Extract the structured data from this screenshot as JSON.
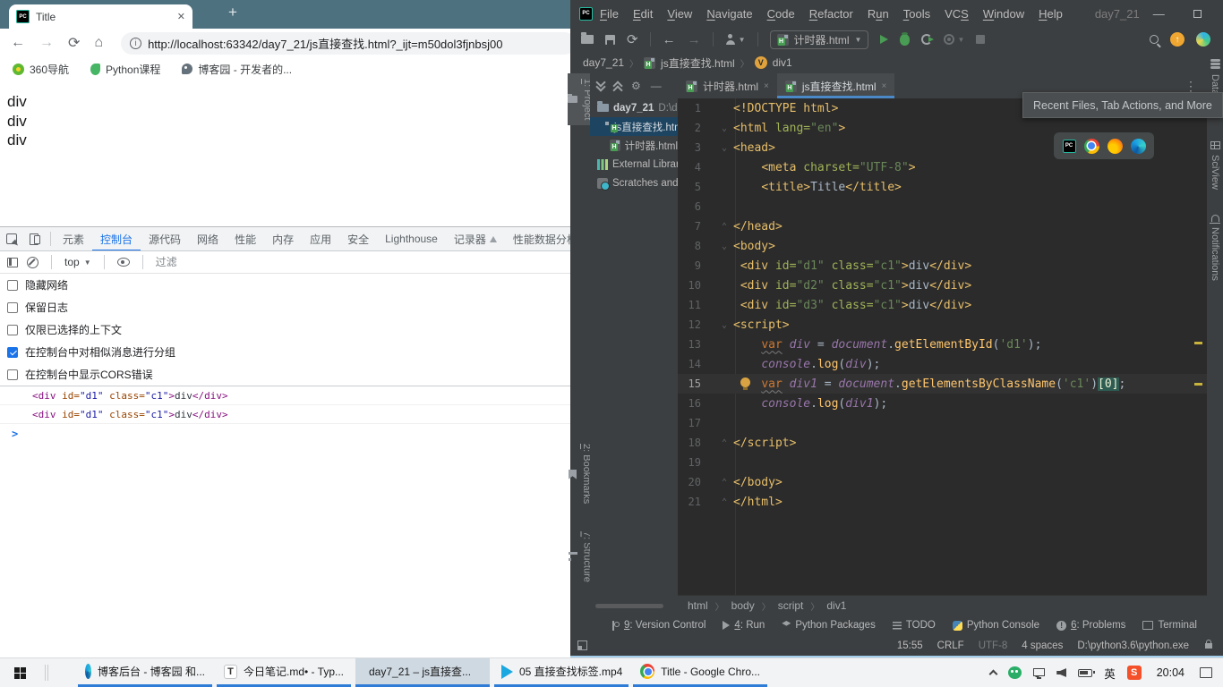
{
  "chrome": {
    "tab_title": "Title",
    "new_tab": "+",
    "url": "http://localhost:63342/day7_21/js直接查找.html?_ijt=m50dol3fjnbsj00",
    "bookmarks": [
      {
        "icon": "nav360",
        "label": "360导航"
      },
      {
        "icon": "pyclass",
        "label": "Python课程"
      },
      {
        "icon": "blog",
        "label": "博客园 - 开发者的..."
      }
    ],
    "page_lines": [
      "div",
      "div",
      "div"
    ],
    "devtools": {
      "tabs": [
        {
          "label": "元素"
        },
        {
          "label": "控制台",
          "active": true
        },
        {
          "label": "源代码"
        },
        {
          "label": "网络"
        },
        {
          "label": "性能"
        },
        {
          "label": "内存"
        },
        {
          "label": "应用"
        },
        {
          "label": "安全"
        },
        {
          "label": "Lighthouse"
        },
        {
          "label": "记录器",
          "badge": true
        },
        {
          "label": "性能数据分析"
        }
      ],
      "context": "top",
      "filter_placeholder": "过滤",
      "checkboxes": [
        {
          "label": "隐藏网络",
          "checked": false
        },
        {
          "label": "保留日志",
          "checked": false
        },
        {
          "label": "仅限已选择的上下文",
          "checked": false
        },
        {
          "label": "在控制台中对相似消息进行分组",
          "checked": true
        },
        {
          "label": "在控制台中显示CORS错误",
          "checked": false
        }
      ],
      "messages": [
        [
          [
            "t",
            "<div"
          ],
          [
            "a",
            " id="
          ],
          [
            "v",
            "\"d1\""
          ],
          [
            "a",
            " class="
          ],
          [
            "v",
            "\"c1\""
          ],
          [
            "t",
            ">"
          ],
          [
            "x",
            "div"
          ],
          [
            "t",
            "</div>"
          ]
        ],
        [
          [
            "t",
            "<div"
          ],
          [
            "a",
            " id="
          ],
          [
            "v",
            "\"d1\""
          ],
          [
            "a",
            " class="
          ],
          [
            "v",
            "\"c1\""
          ],
          [
            "t",
            ">"
          ],
          [
            "x",
            "div"
          ],
          [
            "t",
            "</div>"
          ]
        ]
      ],
      "prompt": ">"
    }
  },
  "pycharm": {
    "menus": [
      {
        "label": "File",
        "u": 0
      },
      {
        "label": "Edit",
        "u": 0
      },
      {
        "label": "View",
        "u": 0
      },
      {
        "label": "Navigate",
        "u": 0
      },
      {
        "label": "Code",
        "u": 0
      },
      {
        "label": "Refactor",
        "u": 0
      },
      {
        "label": "Run",
        "u": 1
      },
      {
        "label": "Tools",
        "u": 0
      },
      {
        "label": "VCS",
        "u": 2
      },
      {
        "label": "Window",
        "u": 0
      },
      {
        "label": "Help",
        "u": 0
      }
    ],
    "window_title": "day7_21",
    "run_config": "计时器.html",
    "crumbs_top": [
      "day7_21",
      "js直接查找.html",
      "div1"
    ],
    "left_strip": [
      {
        "key": "1",
        "label": "Project",
        "icon": "project",
        "active": true,
        "gap": 0
      },
      {
        "key": "2",
        "label": "Bookmarks",
        "icon": "bookmark",
        "gap": 350
      },
      {
        "key": "7",
        "label": "Structure",
        "icon": "structure",
        "gap": 18
      }
    ],
    "project_tree": [
      {
        "label": "day7_21",
        "suffix": " D:\\d",
        "icon": "folder",
        "indent": 0,
        "bold": true
      },
      {
        "label": "js直接查找.html",
        "icon": "html",
        "indent": 1,
        "selected": true
      },
      {
        "label": "计时器.html",
        "icon": "html",
        "indent": 1
      },
      {
        "label": "External Libraries",
        "icon": "libs",
        "indent": 0
      },
      {
        "label": "Scratches and Consoles",
        "icon": "scratch",
        "indent": 0
      }
    ],
    "tabs": [
      {
        "label": "计时器.html"
      },
      {
        "label": "js直接查找.html",
        "active": true
      }
    ],
    "tab_close": "×",
    "tooltip": "Recent Files, Tab Actions, and More",
    "code_lines": [
      {
        "n": 1,
        "tokens": [
          [
            "tag",
            "<!DOCTYPE html>"
          ]
        ]
      },
      {
        "n": 2,
        "fold": "o",
        "tokens": [
          [
            "tag",
            "<html"
          ],
          [
            "attr",
            " lang="
          ],
          [
            "str",
            "\"en\""
          ],
          [
            "tag",
            ">"
          ]
        ]
      },
      {
        "n": 3,
        "fold": "o",
        "tokens": [
          [
            "tag",
            "<head>"
          ]
        ]
      },
      {
        "n": 4,
        "tokens": [
          [
            "plain",
            "    "
          ],
          [
            "tag",
            "<meta"
          ],
          [
            "attr",
            " charset="
          ],
          [
            "str",
            "\"UTF-8\""
          ],
          [
            "tag",
            ">"
          ]
        ]
      },
      {
        "n": 5,
        "tokens": [
          [
            "plain",
            "    "
          ],
          [
            "tag",
            "<title>"
          ],
          [
            "text",
            "Title"
          ],
          [
            "tag",
            "</title>"
          ]
        ]
      },
      {
        "n": 6,
        "tokens": []
      },
      {
        "n": 7,
        "fold": "c",
        "tokens": [
          [
            "tag",
            "</head>"
          ]
        ]
      },
      {
        "n": 8,
        "fold": "o",
        "tokens": [
          [
            "tag",
            "<body>"
          ]
        ]
      },
      {
        "n": 9,
        "tokens": [
          [
            "plain",
            " "
          ],
          [
            "tag",
            "<div"
          ],
          [
            "attr",
            " id="
          ],
          [
            "str",
            "\"d1\""
          ],
          [
            "attr",
            " class="
          ],
          [
            "str",
            "\"c1\""
          ],
          [
            "tag",
            ">"
          ],
          [
            "text",
            "div"
          ],
          [
            "tag",
            "</div>"
          ]
        ]
      },
      {
        "n": 10,
        "tokens": [
          [
            "plain",
            " "
          ],
          [
            "tag",
            "<div"
          ],
          [
            "attr",
            " id="
          ],
          [
            "str",
            "\"d2\""
          ],
          [
            "attr",
            " class="
          ],
          [
            "str",
            "\"c1\""
          ],
          [
            "tag",
            ">"
          ],
          [
            "text",
            "div"
          ],
          [
            "tag",
            "</div>"
          ]
        ]
      },
      {
        "n": 11,
        "tokens": [
          [
            "plain",
            " "
          ],
          [
            "tag",
            "<div"
          ],
          [
            "attr",
            " id="
          ],
          [
            "str",
            "\"d3\""
          ],
          [
            "attr",
            " class="
          ],
          [
            "str",
            "\"c1\""
          ],
          [
            "tag",
            ">"
          ],
          [
            "text",
            "div"
          ],
          [
            "tag",
            "</div>"
          ]
        ]
      },
      {
        "n": 12,
        "fold": "o",
        "tokens": [
          [
            "tag",
            "<script>"
          ]
        ]
      },
      {
        "n": 13,
        "tokens": [
          [
            "plain",
            "    "
          ],
          [
            "kww",
            "var"
          ],
          [
            "plain",
            " "
          ],
          [
            "ident",
            "div"
          ],
          [
            "plain",
            " = "
          ],
          [
            "ident",
            "document"
          ],
          [
            "plain",
            "."
          ],
          [
            "fn",
            "getElementById"
          ],
          [
            "plain",
            "("
          ],
          [
            "str",
            "'d1'"
          ],
          [
            "plain",
            ");"
          ]
        ]
      },
      {
        "n": 14,
        "tokens": [
          [
            "plain",
            "    "
          ],
          [
            "ident",
            "console"
          ],
          [
            "plain",
            "."
          ],
          [
            "fn",
            "log"
          ],
          [
            "plain",
            "("
          ],
          [
            "ident",
            "div"
          ],
          [
            "plain",
            ");"
          ]
        ]
      },
      {
        "n": 15,
        "cur": true,
        "bulb": true,
        "tokens": [
          [
            "plain",
            "    "
          ],
          [
            "kww",
            "var"
          ],
          [
            "plain",
            " "
          ],
          [
            "ident",
            "div1"
          ],
          [
            "plain",
            " = "
          ],
          [
            "ident",
            "document"
          ],
          [
            "plain",
            "."
          ],
          [
            "fn",
            "getElementsByClassName"
          ],
          [
            "plain",
            "("
          ],
          [
            "str",
            "'c1'"
          ],
          [
            "plain",
            ")"
          ],
          [
            "hl",
            "[0]"
          ],
          [
            "plain",
            ";"
          ]
        ]
      },
      {
        "n": 16,
        "tokens": [
          [
            "plain",
            "    "
          ],
          [
            "ident",
            "console"
          ],
          [
            "plain",
            "."
          ],
          [
            "fn",
            "log"
          ],
          [
            "plain",
            "("
          ],
          [
            "ident",
            "div1"
          ],
          [
            "plain",
            ");"
          ]
        ]
      },
      {
        "n": 17,
        "tokens": []
      },
      {
        "n": 18,
        "fold": "c",
        "tokens": [
          [
            "tag",
            "</script>"
          ]
        ]
      },
      {
        "n": 19,
        "tokens": []
      },
      {
        "n": 20,
        "fold": "c",
        "tokens": [
          [
            "tag",
            "</body>"
          ]
        ]
      },
      {
        "n": 21,
        "fold": "c",
        "tokens": [
          [
            "tag",
            "</html>"
          ]
        ]
      }
    ],
    "right_strip": [
      {
        "label": "Database",
        "icon": "db"
      },
      {
        "label": "SciView",
        "icon": "grid"
      },
      {
        "label": "Notifications",
        "icon": "bell"
      }
    ],
    "crumbs_bottom": [
      "html",
      "body",
      "script",
      "div1"
    ],
    "toolwindows": [
      {
        "key": "9",
        "label": "Version Control",
        "icon": "branch"
      },
      {
        "key": "4",
        "label": "Run",
        "icon": "run"
      },
      {
        "label": "Python Packages",
        "icon": "packages"
      },
      {
        "label": "TODO",
        "icon": "todo"
      },
      {
        "label": "Python Console",
        "icon": "python"
      },
      {
        "key": "6",
        "label": "Problems",
        "icon": "problems"
      },
      {
        "label": "Terminal",
        "icon": "terminal"
      }
    ],
    "problems_badge": "!",
    "status": [
      {
        "text": "15:55"
      },
      {
        "text": "CRLF"
      },
      {
        "text": "UTF-8",
        "dim": true
      },
      {
        "text": "4 spaces"
      },
      {
        "text": "D:\\python3.6\\python.exe"
      }
    ]
  },
  "taskbar": {
    "buttons": [
      {
        "icon": "edge",
        "label": "博客后台 - 博客园 和..."
      },
      {
        "icon": "typora",
        "label": "今日笔记.md• - Typ...",
        "glyph": "T"
      },
      {
        "icon": "pycharm",
        "label": "day7_21 – js直接查...",
        "active": true
      },
      {
        "icon": "video",
        "label": "05 直接查找标签.mp4"
      },
      {
        "icon": "chrome",
        "label": "Title - Google Chro..."
      }
    ],
    "tray": [
      {
        "icon": "chevron",
        "name": "tray-expand"
      },
      {
        "icon": "wechat",
        "name": "wechat"
      },
      {
        "icon": "network",
        "name": "network"
      },
      {
        "icon": "volume",
        "name": "volume"
      },
      {
        "icon": "battery",
        "name": "battery"
      },
      {
        "icon": "ime",
        "name": "input-method",
        "label": "英"
      },
      {
        "icon": "sogou",
        "name": "sogou",
        "label": "S"
      }
    ],
    "time": "20:04"
  },
  "colors": {
    "chrome_frame": "#4e7180",
    "devtools_accent": "#1a73e8",
    "pycharm_bg": "#3c3f41",
    "editor_bg": "#2b2b2b",
    "tab_underline": "#4a88c7",
    "taskbar_underline": "#2e7cd6"
  }
}
